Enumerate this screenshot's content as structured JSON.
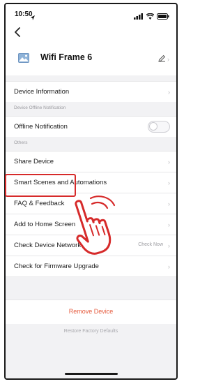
{
  "status_bar": {
    "time": "10:50",
    "icons": [
      "location-arrow-icon",
      "signal-icon",
      "wifi-icon",
      "battery-icon"
    ]
  },
  "nav": {
    "back_icon": "chevron-left-icon"
  },
  "device": {
    "name": "Wifi Frame 6",
    "thumb_icon": "image-icon",
    "edit_icon": "pencil-icon"
  },
  "settings": {
    "device_information": "Device Information",
    "offline_section_label": "Device Offline Notification",
    "offline_notification": "Offline Notification",
    "offline_notification_enabled": false,
    "others_section_label": "Others",
    "share_device": "Share Device",
    "smart_scenes": "Smart Scenes and Automations",
    "faq_feedback": "FAQ & Feedback",
    "add_home_screen": "Add to Home Screen",
    "check_network": "Check Device Network",
    "check_network_value": "Check Now",
    "check_firmware": "Check for Firmware Upgrade"
  },
  "actions": {
    "remove_device": "Remove Device",
    "restore_defaults": "Restore Factory Defaults"
  },
  "overlay": {
    "highlight_target": "Share Device",
    "pointer_icon": "hand-pointer-icon"
  },
  "colors": {
    "accent_red": "#d62a2a",
    "remove_text": "#e55a3c",
    "background": "#f2f2f4"
  }
}
